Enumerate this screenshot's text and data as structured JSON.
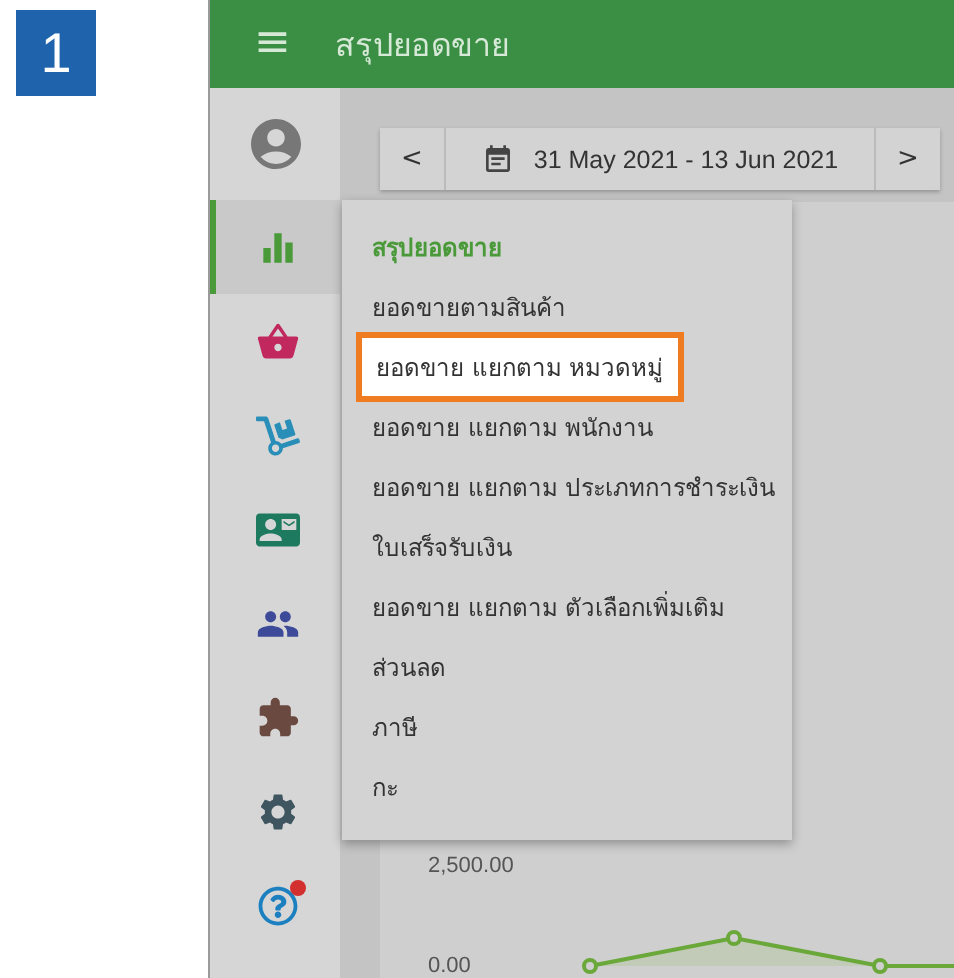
{
  "step": {
    "number": "1"
  },
  "header": {
    "title": "สรุปยอดขาย",
    "menu_icon": "≡"
  },
  "date_picker": {
    "prev": "<",
    "range": "31 May 2021 - 13 Jun 2021",
    "next": ">"
  },
  "sidebar": {
    "items": [
      {
        "selected": true,
        "color": "#4a9a3a",
        "notification": false
      },
      {
        "selected": false,
        "color": "#c0285e",
        "notification": false
      },
      {
        "selected": false,
        "color": "#2a8fb8",
        "notification": false
      },
      {
        "selected": false,
        "color": "#1d7a5e",
        "notification": false
      },
      {
        "selected": false,
        "color": "#3d4a9a",
        "notification": false
      },
      {
        "selected": false,
        "color": "#6a4a40",
        "notification": false
      },
      {
        "selected": false,
        "color": "#3f5560",
        "notification": false
      },
      {
        "selected": false,
        "color": "#1b7fc0",
        "notification": true
      }
    ]
  },
  "menu": {
    "items": [
      {
        "kind": "header",
        "label": "สรุปยอดขาย",
        "highlighted": false
      },
      {
        "kind": "item",
        "label": "ยอดขายตามสินค้า",
        "highlighted": false
      },
      {
        "kind": "item",
        "label": "ยอดขาย แยกตาม หมวดหมู่",
        "highlighted": true
      },
      {
        "kind": "item",
        "label": "ยอดขาย แยกตาม พนักงาน",
        "highlighted": false
      },
      {
        "kind": "item",
        "label": "ยอดขาย แยกตาม ประเภทการชำระเงิน",
        "highlighted": false
      },
      {
        "kind": "item",
        "label": "ใบเสร็จรับเงิน",
        "highlighted": false
      },
      {
        "kind": "item",
        "label": "ยอดขาย แยกตาม ตัวเลือกเพิ่มเติม",
        "highlighted": false
      },
      {
        "kind": "item",
        "label": "ส่วนลด",
        "highlighted": false
      },
      {
        "kind": "item",
        "label": "ภาษี",
        "highlighted": false
      },
      {
        "kind": "item",
        "label": "กะ",
        "highlighted": false
      }
    ]
  },
  "chart": {
    "axis_labels": [
      "2,500.00",
      "0.00"
    ]
  }
}
